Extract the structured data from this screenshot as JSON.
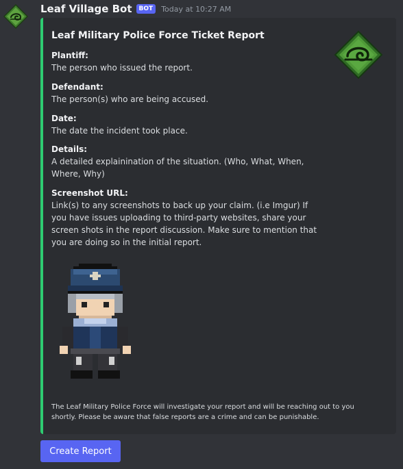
{
  "message": {
    "author": "Leaf Village Bot",
    "badge": "BOT",
    "timestamp": "Today at 10:27 AM",
    "avatar_icon": "leaf-village-symbol-icon"
  },
  "embed": {
    "accent_color": "#2ecc71",
    "title": "Leaf Military Police Force Ticket Report",
    "thumbnail_icon": "leaf-village-diamond-emblem-icon",
    "fields": [
      {
        "name": "Plantiff:",
        "value": "The person who issued the report."
      },
      {
        "name": "Defendant:",
        "value": "The person(s) who are being accused."
      },
      {
        "name": "Date:",
        "value": "The date the incident took place."
      },
      {
        "name": "Details:",
        "value": "A detailed explainination of the situation. (Who, What, When, Where, Why)"
      },
      {
        "name": "Screenshot URL:",
        "value": "Link(s) to any screenshots to back up your claim. (i.e Imgur) If you have issues uploading to third-party websites, share your screen shots in the report discussion. Make sure to mention that you are doing so in the initial report."
      }
    ],
    "image_icon": "military-police-sprite-icon",
    "footer": "The Leaf Military Police Force will investigate your report and will be reaching out to you shortly. Please be aware that false reports are a crime and can be punishable."
  },
  "buttons": {
    "create_report": "Create Report",
    "color": "#5865f2"
  }
}
